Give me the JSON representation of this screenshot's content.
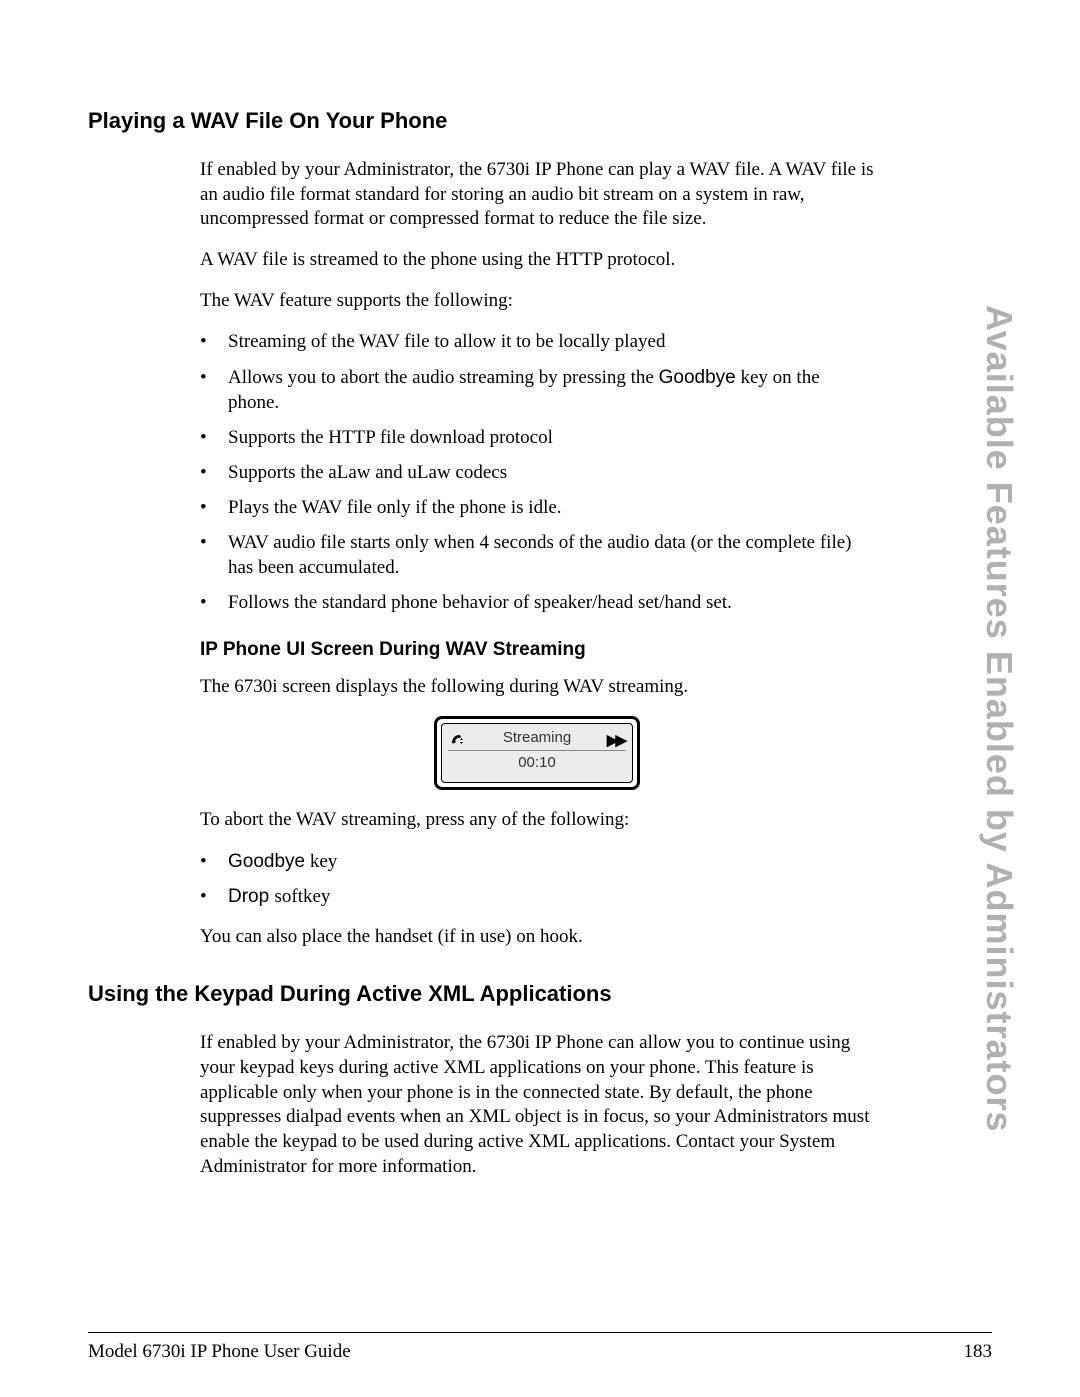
{
  "side_label": "Available Features Enabled by Administrators",
  "section1": {
    "heading": "Playing a WAV File On Your Phone",
    "p1": "If enabled by your Administrator, the 6730i IP Phone can play a WAV file. A WAV file is an audio file format standard for storing an audio bit stream on a system in raw, uncompressed format or compressed format to reduce the file size.",
    "p2": "A WAV file is streamed to the phone using the HTTP protocol.",
    "p3": "The WAV feature supports the following:",
    "bullets": [
      {
        "text": "Streaming of the WAV file to allow it to be locally played"
      },
      {
        "pre": "Allows you to abort the audio streaming by pressing the ",
        "key": "Goodbye",
        "post": " key on the phone."
      },
      {
        "text": "Supports the HTTP file download protocol"
      },
      {
        "text": "Supports the aLaw and uLaw codecs"
      },
      {
        "text": "Plays the WAV file only if the phone is idle."
      },
      {
        "text": "WAV audio file starts only when 4 seconds of the audio data (or the complete file) has been accumulated."
      },
      {
        "text": "Follows the standard phone behavior of speaker/head set/hand set."
      }
    ],
    "sub_heading": "IP Phone UI Screen During WAV Streaming",
    "p4": "The 6730i screen displays the following during WAV streaming.",
    "screen": {
      "title": "Streaming",
      "time": "00:10"
    },
    "p5": "To abort the WAV streaming, press any of the following:",
    "abort_bullets": [
      {
        "key": "Goodbye",
        "post": " key"
      },
      {
        "key": "Drop ",
        "post": "softkey"
      }
    ],
    "p6": "You can also place the handset (if in use) on hook."
  },
  "section2": {
    "heading": "Using the Keypad During Active XML Applications",
    "p1": "If enabled by your Administrator, the 6730i IP Phone can allow you to continue using your keypad keys during active XML applications on your phone. This feature is applicable only when your phone is in the connected state. By default, the phone suppresses dialpad events when an XML object is in focus, so your Administrators must enable the keypad to be used during active XML applications. Contact your System Administrator for more information."
  },
  "footer": {
    "left": "Model 6730i IP Phone User Guide",
    "page": "183"
  }
}
